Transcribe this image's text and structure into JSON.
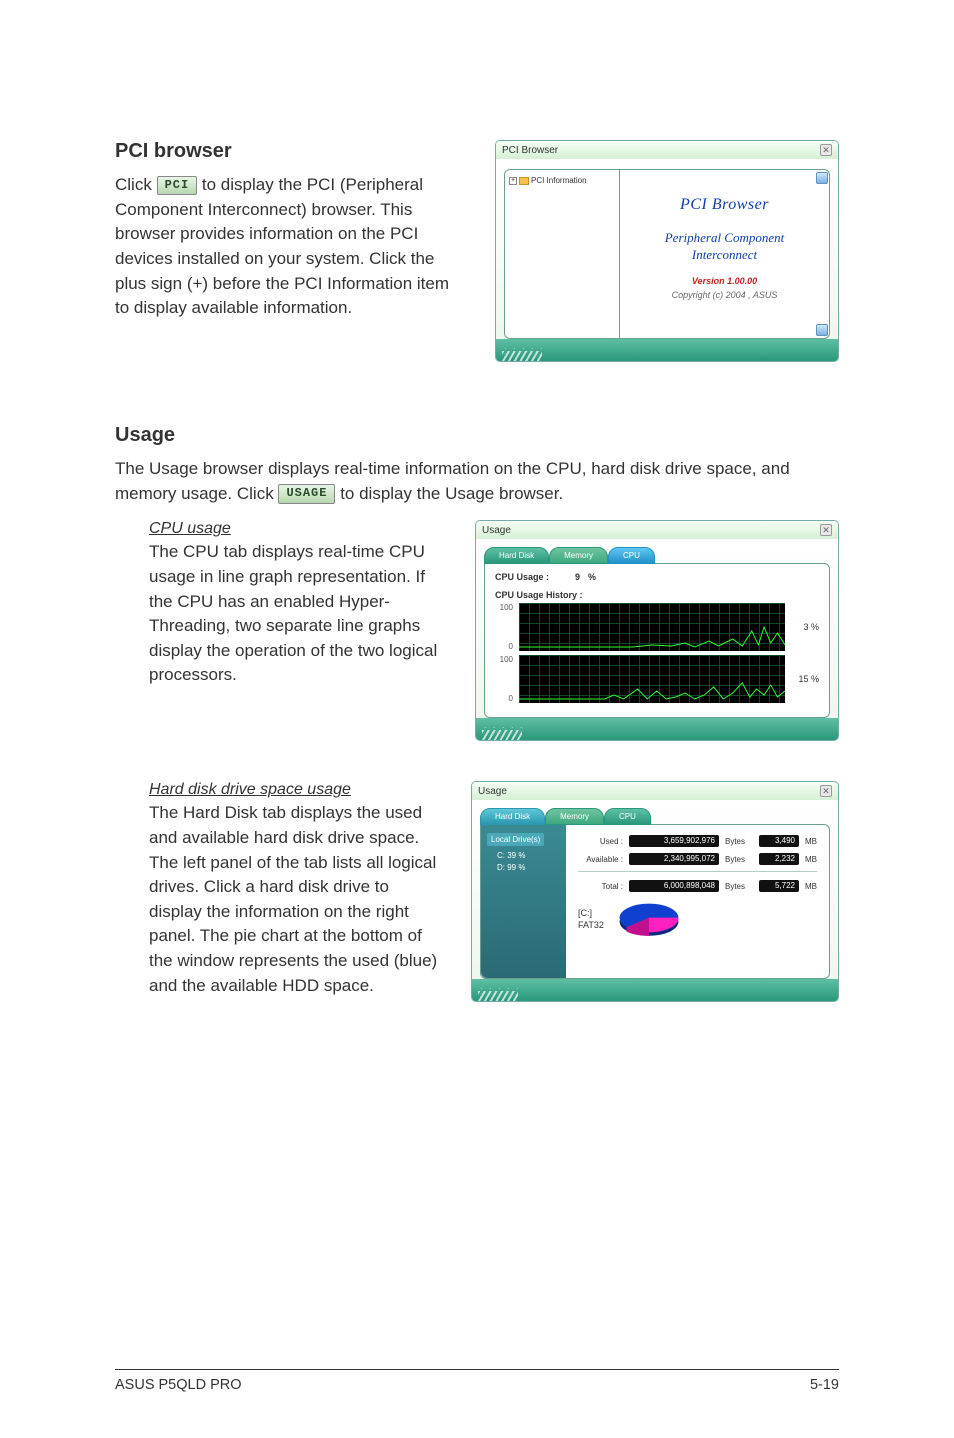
{
  "pci": {
    "heading": "PCI browser",
    "para_pre": "Click ",
    "btn": "PCI",
    "para_post": " to display the PCI (Peripheral Component Interconnect) browser. This browser provides information on the PCI devices installed on your system. Click the plus sign (+) before the PCI Information item to display available information.",
    "shot": {
      "title": "PCI Browser",
      "tree_root": "PCI Information",
      "info_title": "PCI Browser",
      "info_sub1": "Peripheral Component",
      "info_sub2": "Interconnect",
      "version": "Version 1.00.00",
      "copyright": "Copyright (c) 2004 , ASUS"
    }
  },
  "usage": {
    "heading": "Usage",
    "para_pre": "The Usage browser displays real-time information on the CPU, hard disk drive space, and memory usage. Click ",
    "btn": "USAGE",
    "para_post": " to display the Usage browser.",
    "cpu": {
      "subhead": "CPU usage",
      "para": "The CPU tab displays real-time CPU usage in line graph representation. If the CPU has an enabled Hyper-Threading, two separate line graphs display the operation of the two logical processors.",
      "shot": {
        "title": "Usage",
        "tab_hd": "Hard Disk",
        "tab_mem": "Memory",
        "tab_cpu": "CPU",
        "cpu_usage_lbl": "CPU Usage :",
        "cpu_usage_val": "9",
        "cpu_usage_unit": "%",
        "history_lbl": "CPU Usage History :",
        "axis_hi": "100",
        "axis_lo": "0",
        "pct1": "3 %",
        "pct2": "15 %"
      }
    },
    "hdd": {
      "subhead": "Hard disk drive space usage",
      "para": "The Hard Disk tab displays the used and available hard disk drive space. The left panel of the tab lists all logical drives. Click a hard disk drive to display the information on the right panel. The pie chart at the bottom of the window represents the used (blue) and the available HDD space.",
      "shot": {
        "title": "Usage",
        "tab_hd": "Hard Disk",
        "tab_mem": "Memory",
        "tab_cpu": "CPU",
        "tree_root": "Local Drive(s)",
        "drive_c": "C: 39 %",
        "drive_d": "D: 99 %",
        "used_lbl": "Used :",
        "used_bytes": "3,659,902,976",
        "used_mb": "3,490",
        "avail_lbl": "Available :",
        "avail_bytes": "2,340,995,072",
        "avail_mb": "2,232",
        "total_lbl": "Total :",
        "total_bytes": "6,000,898,048",
        "total_mb": "5,722",
        "bytes_unit": "Bytes",
        "mb_unit": "MB",
        "drive_lbl": "[C:]",
        "fs_lbl": "FAT32"
      }
    }
  },
  "chart_data": [
    {
      "type": "line",
      "title": "CPU Usage History (logical processor 1)",
      "ylim": [
        0,
        100
      ],
      "y_current": 3,
      "note": "real-time scrolling cpu graph, low activity with small spikes near right edge"
    },
    {
      "type": "line",
      "title": "CPU Usage History (logical processor 2)",
      "ylim": [
        0,
        100
      ],
      "y_current": 15,
      "note": "real-time scrolling cpu graph, slightly more spiky activity"
    },
    {
      "type": "pie",
      "title": "[C:] FAT32 disk usage",
      "series": [
        {
          "name": "Used (blue)",
          "value": 3659902976,
          "mb": 3490
        },
        {
          "name": "Available (magenta)",
          "value": 2340995072,
          "mb": 2232
        }
      ],
      "total_bytes": 6000898048,
      "total_mb": 5722
    }
  ],
  "footer": {
    "left": "ASUS P5QLD PRO",
    "right": "5-19"
  }
}
